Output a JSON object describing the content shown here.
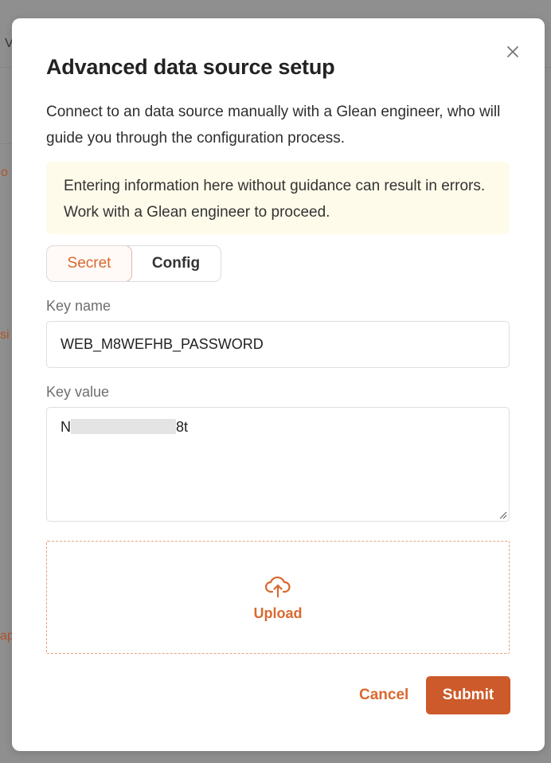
{
  "modal": {
    "title": "Advanced data source setup",
    "description": "Connect to an data source manually with a Glean engineer, who will guide you through the configuration process.",
    "warning": "Entering information here without guidance can result in errors. Work with a Glean engineer to proceed.",
    "close_icon": "close-icon",
    "tabs": [
      {
        "label": "Secret",
        "active": true
      },
      {
        "label": "Config",
        "active": false
      }
    ],
    "key_name": {
      "label": "Key name",
      "value": "WEB_M8WEFHB_PASSWORD"
    },
    "key_value": {
      "label": "Key value",
      "value_start": "N",
      "value_end": "8t"
    },
    "upload": {
      "label": "Upload",
      "icon": "cloud-upload-icon"
    },
    "actions": {
      "cancel_label": "Cancel",
      "submit_label": "Submit"
    }
  },
  "background": {
    "fragments": [
      "V",
      "o",
      "si",
      "ap"
    ]
  },
  "colors": {
    "accent": "#d9692f",
    "submit_bg": "#cc5a2a",
    "warning_bg": "#fffbea",
    "overlay": "#8f8f8f"
  }
}
